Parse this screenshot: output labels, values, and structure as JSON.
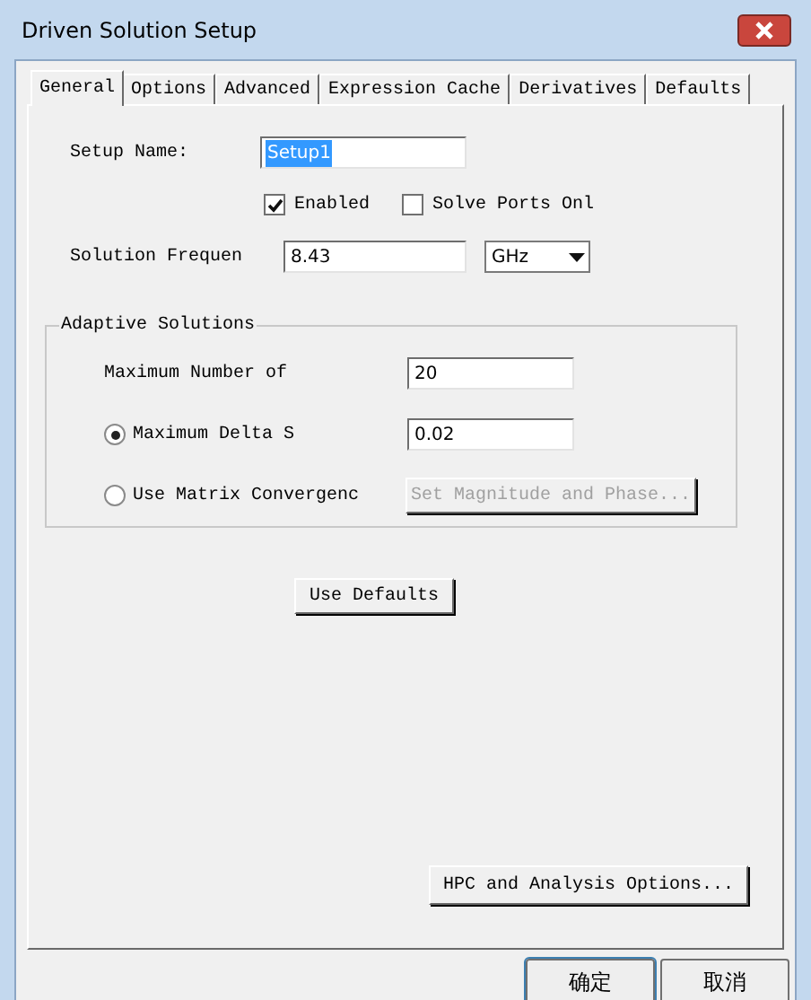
{
  "window": {
    "title": "Driven Solution Setup"
  },
  "tabs": [
    {
      "label": "General",
      "selected": true
    },
    {
      "label": "Options",
      "selected": false
    },
    {
      "label": "Advanced",
      "selected": false
    },
    {
      "label": "Expression Cache",
      "selected": false
    },
    {
      "label": "Derivatives",
      "selected": false
    },
    {
      "label": "Defaults",
      "selected": false
    }
  ],
  "setup_name": {
    "label": "Setup Name:",
    "value": "Setup1",
    "text_selected": true
  },
  "checkboxes": [
    {
      "label": "Enabled",
      "checked": true
    },
    {
      "label": "Solve Ports Onl",
      "checked": false
    }
  ],
  "frequency": {
    "label": "Solution Frequen",
    "value": "8.43",
    "unit": "GHz"
  },
  "adaptive": {
    "title": "Adaptive Solutions",
    "rows": [
      {
        "kind": "field",
        "label": "Maximum Number of",
        "value": "20"
      },
      {
        "kind": "radio",
        "label": "Maximum Delta S",
        "selected": true,
        "value": "0.02"
      },
      {
        "kind": "radio",
        "label": "Use Matrix Convergenc",
        "selected": false,
        "button": {
          "label": "Set Magnitude and Phase...",
          "disabled": true
        }
      }
    ]
  },
  "use_defaults": "Use Defaults",
  "hpc_button": "HPC and Analysis Options...",
  "dialog_buttons": [
    "确定",
    "取消"
  ]
}
